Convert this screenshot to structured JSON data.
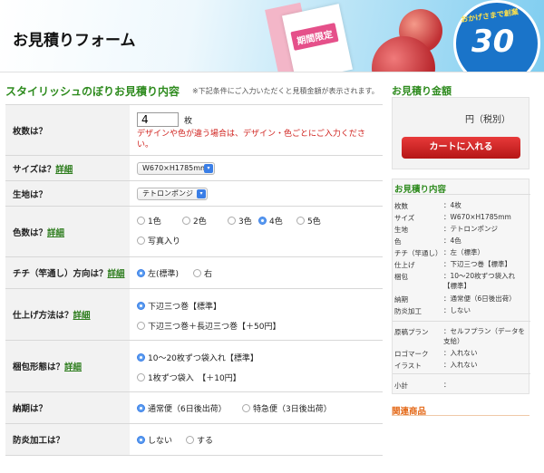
{
  "banner": {
    "title": "お見積りフォーム",
    "badge": "期間限定",
    "circle_text": "おかげさまで創業",
    "circle_num": "30"
  },
  "form": {
    "title": "スタイリッシュのぼりお見積り内容",
    "note": "※下記条件にご入力いただくと見積金額が表示されます。",
    "detail_link": "詳細",
    "quantity": {
      "label": "枚数は？",
      "value": "4",
      "unit": "枚",
      "warning": "デザインや色が違う場合は、デザイン・色ごとにご入力ください。"
    },
    "size": {
      "label": "サイズは？",
      "selected": "W670×H1785mm"
    },
    "fabric": {
      "label": "生地は？",
      "selected": "テトロンポンジ"
    },
    "colors": {
      "label": "色数は？",
      "options": [
        "1色",
        "2色",
        "3色",
        "4色",
        "5色",
        "写真入り"
      ],
      "selected_index": 3
    },
    "chichi": {
      "label": "チチ（竿通し）方向は？",
      "options": [
        "左(標準)",
        "右"
      ],
      "selected_index": 0
    },
    "finish": {
      "label": "仕上げ方法は？",
      "options": [
        "下辺三つ巻【標準】",
        "下辺三つ巻＋長辺三つ巻【＋50円】"
      ],
      "selected_index": 0
    },
    "packing": {
      "label": "梱包形態は？",
      "options": [
        "10〜20枚ずつ袋入れ【標準】",
        "1枚ずつ袋入　【＋10円】"
      ],
      "selected_index": 0
    },
    "delivery": {
      "label": "納期は？",
      "options": [
        "通常便（6日後出荷）",
        "特急便（3日後出荷）"
      ],
      "selected_index": 0
    },
    "fireproof": {
      "label": "防炎加工は？",
      "options": [
        "しない",
        "する"
      ],
      "selected_index": 0
    }
  },
  "side": {
    "price_title": "お見積り金額",
    "price_text": "円（税別）",
    "cart_button": "カートに入れる",
    "estimate_title": "お見積り内容",
    "estimate": [
      {
        "k": "枚数",
        "v": "：4枚"
      },
      {
        "k": "サイズ",
        "v": "：W670×H1785mm"
      },
      {
        "k": "生地",
        "v": "：テトロンポンジ"
      },
      {
        "k": "色",
        "v": "：4色"
      },
      {
        "k": "チチ（竿通し）",
        "v": "：左（標準）"
      },
      {
        "k": "仕上げ",
        "v": "：下辺三つ巻【標準】"
      },
      {
        "k": "梱包",
        "v": "：10〜20枚ずつ袋入れ【標準】"
      },
      {
        "k": "納期",
        "v": "：通常便（6日後出荷）"
      },
      {
        "k": "防炎加工",
        "v": "：しない"
      },
      {
        "k": "原稿プラン",
        "v": "：セルフプラン（データを支給）"
      },
      {
        "k": "ロゴマーク",
        "v": "：入れない"
      },
      {
        "k": "イラスト",
        "v": "：入れない"
      },
      {
        "k": "小計",
        "v": "："
      }
    ],
    "related_title": "関連商品"
  }
}
